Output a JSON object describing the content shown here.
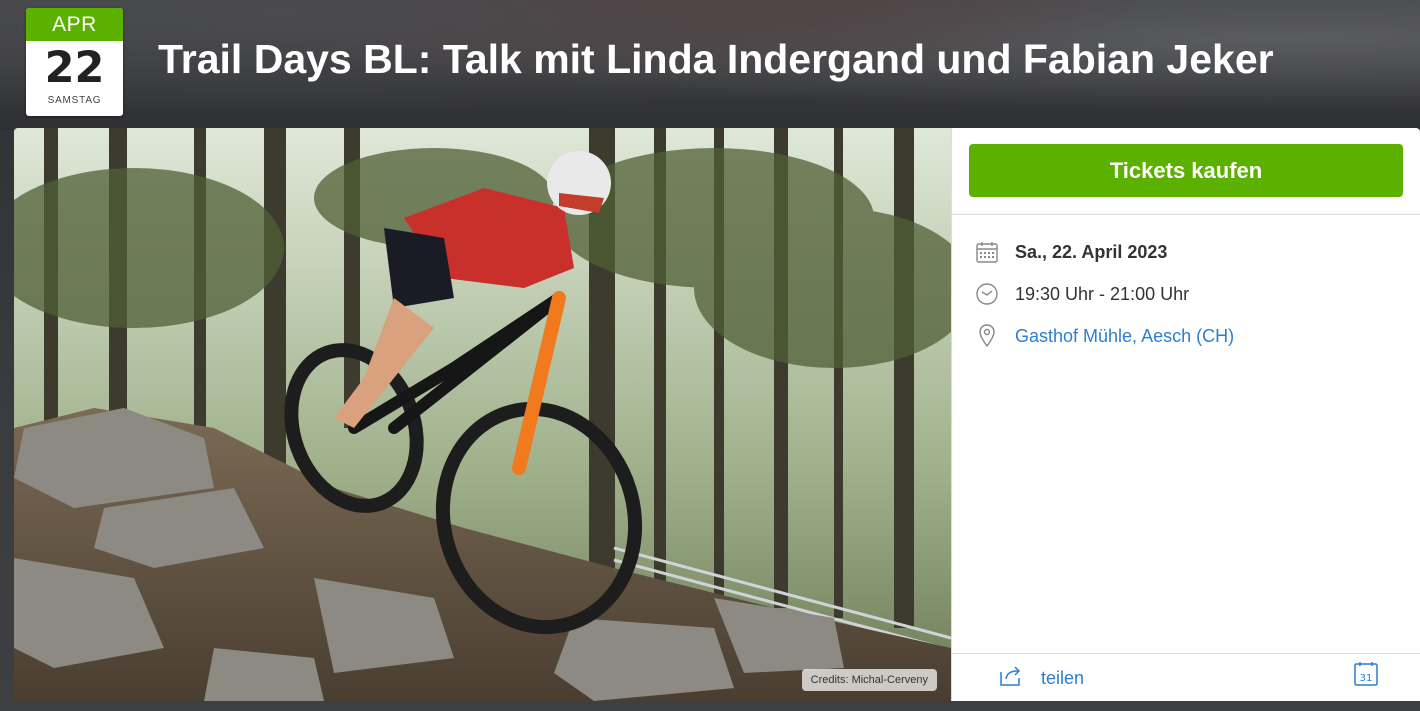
{
  "event": {
    "month": "APR",
    "day": "22",
    "weekday": "SAMSTAG",
    "title": "Trail Days BL: Talk mit Linda Indergand und Fabian Jeker"
  },
  "photo": {
    "credits": "Credits: Michal-Cerveny"
  },
  "panel": {
    "tickets_label": "Tickets kaufen",
    "date": "Sa., 22. April 2023",
    "time": "19:30 Uhr - 21:00 Uhr",
    "location": "Gasthof Mühle, Aesch (CH)",
    "share_label": "teilen",
    "calendar_icon_text": "31"
  },
  "colors": {
    "accent_green": "#5cb100",
    "link_blue": "#2a7ed4"
  },
  "icons": [
    "calendar-icon",
    "clock-icon",
    "map-pin-icon",
    "share-icon",
    "add-to-calendar-icon"
  ]
}
